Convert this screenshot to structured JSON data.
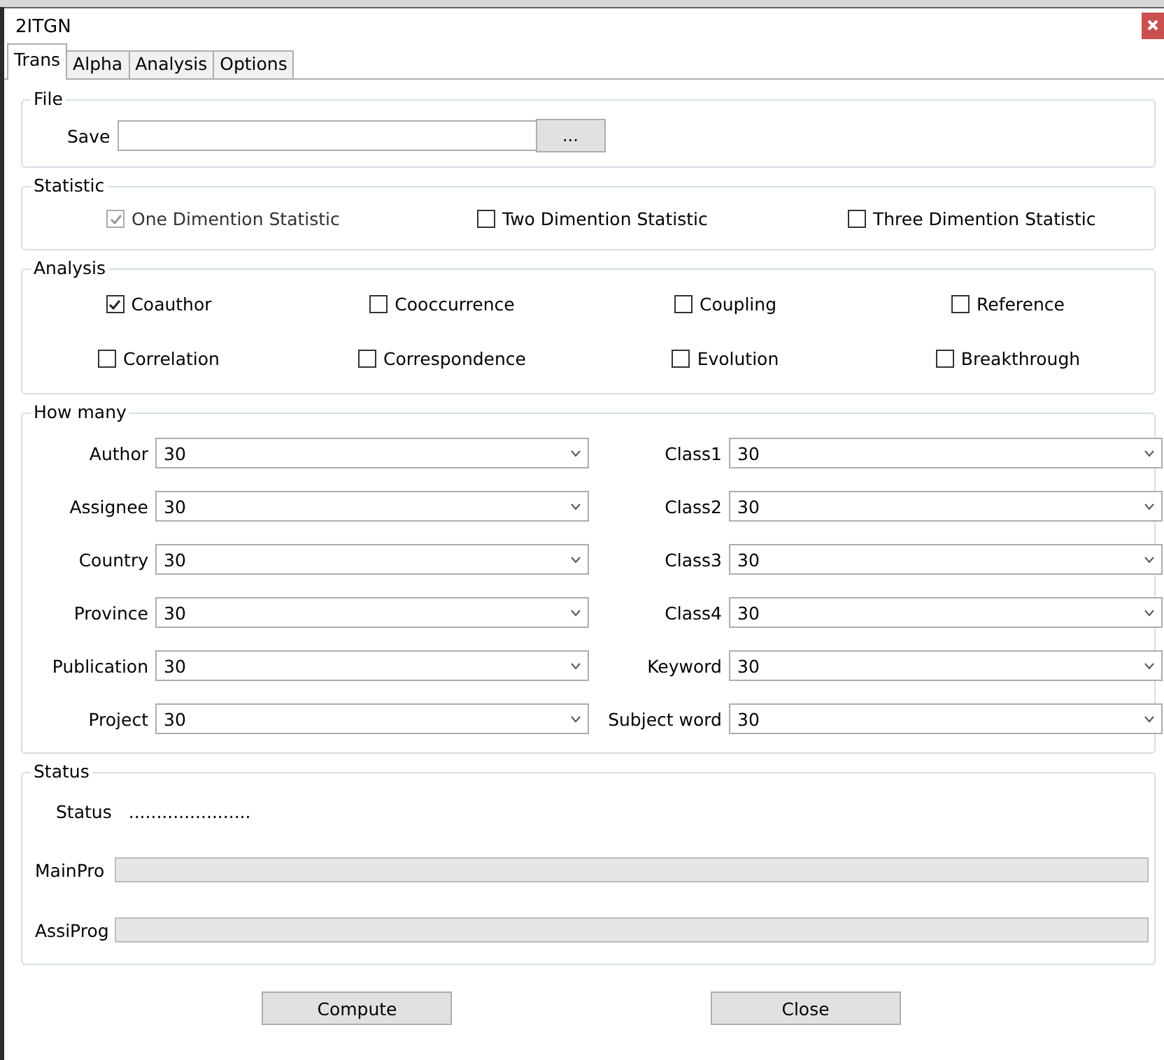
{
  "window": {
    "title": "2ITGN"
  },
  "tabs": [
    {
      "label": "Trans",
      "selected": true
    },
    {
      "label": "Alpha",
      "selected": false
    },
    {
      "label": "Analysis",
      "selected": false
    },
    {
      "label": "Options",
      "selected": false
    }
  ],
  "file": {
    "legend": "File",
    "save_label": "Save",
    "browse_button": "..."
  },
  "statistic": {
    "legend": "Statistic",
    "options": [
      {
        "label": "One Dimention Statistic",
        "checked": true,
        "disabled": true
      },
      {
        "label": "Two Dimention Statistic",
        "checked": false,
        "disabled": false
      },
      {
        "label": "Three Dimention Statistic",
        "checked": false,
        "disabled": false
      }
    ]
  },
  "analysis": {
    "legend": "Analysis",
    "options": [
      {
        "label": "Coauthor",
        "checked": true
      },
      {
        "label": "Cooccurrence",
        "checked": false
      },
      {
        "label": "Coupling",
        "checked": false
      },
      {
        "label": "Reference",
        "checked": false
      },
      {
        "label": "Correlation",
        "checked": false
      },
      {
        "label": "Correspondence",
        "checked": false
      },
      {
        "label": "Evolution",
        "checked": false
      },
      {
        "label": "Breakthrough",
        "checked": false
      }
    ]
  },
  "how_many": {
    "legend": "How many",
    "fields": [
      {
        "label": "Author",
        "value": "30"
      },
      {
        "label": "Class1",
        "value": "30"
      },
      {
        "label": "Assignee",
        "value": "30"
      },
      {
        "label": "Class2",
        "value": "30"
      },
      {
        "label": "Country",
        "value": "30"
      },
      {
        "label": "Class3",
        "value": "30"
      },
      {
        "label": "Province",
        "value": "30"
      },
      {
        "label": "Class4",
        "value": "30"
      },
      {
        "label": "Publication",
        "value": "30"
      },
      {
        "label": "Keyword",
        "value": "30"
      },
      {
        "label": "Project",
        "value": "30"
      },
      {
        "label": "Subject word",
        "value": "30"
      }
    ]
  },
  "status": {
    "legend": "Status",
    "status_label": "Status",
    "status_value": "......................",
    "progress": [
      {
        "label": "MainPro",
        "level": 0
      },
      {
        "label": "AssiProg",
        "level": 0
      }
    ]
  },
  "buttons": [
    "Compute",
    "Close"
  ]
}
